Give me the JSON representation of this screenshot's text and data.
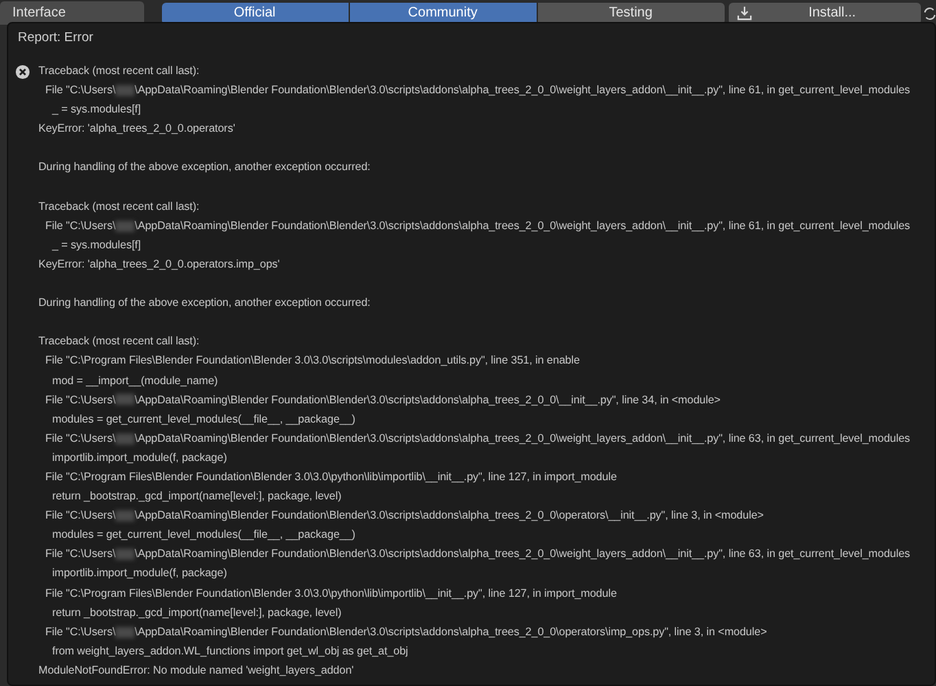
{
  "section_tab": {
    "label": "Interface"
  },
  "tabs": [
    {
      "label": "Official",
      "selected": true
    },
    {
      "label": "Community",
      "selected": true
    },
    {
      "label": "Testing",
      "selected": false
    }
  ],
  "install_button": {
    "label": "Install..."
  },
  "report": {
    "title": "Report: Error",
    "lines": [
      {
        "kind": "header",
        "text": "Traceback (most recent call last):"
      },
      {
        "kind": "file",
        "text": "File \"C:\\Users\\",
        "text_after": "\\AppData\\Roaming\\Blender Foundation\\Blender\\3.0\\scripts\\addons\\alpha_trees_2_0_0\\weight_layers_addon\\__init__.py\", line 61, in get_current_level_modules"
      },
      {
        "kind": "code",
        "text": "_ = sys.modules[f]"
      },
      {
        "kind": "header",
        "text": "KeyError: 'alpha_trees_2_0_0.operators'"
      },
      {
        "kind": "blank"
      },
      {
        "kind": "header",
        "text": "During handling of the above exception, another exception occurred:"
      },
      {
        "kind": "blank"
      },
      {
        "kind": "header",
        "text": "Traceback (most recent call last):"
      },
      {
        "kind": "file",
        "text": "File \"C:\\Users\\",
        "text_after": "\\AppData\\Roaming\\Blender Foundation\\Blender\\3.0\\scripts\\addons\\alpha_trees_2_0_0\\weight_layers_addon\\__init__.py\", line 61, in get_current_level_modules"
      },
      {
        "kind": "code",
        "text": "_ = sys.modules[f]"
      },
      {
        "kind": "header",
        "text": "KeyError: 'alpha_trees_2_0_0.operators.imp_ops'"
      },
      {
        "kind": "blank"
      },
      {
        "kind": "header",
        "text": "During handling of the above exception, another exception occurred:"
      },
      {
        "kind": "blank"
      },
      {
        "kind": "header",
        "text": "Traceback (most recent call last):"
      },
      {
        "kind": "file",
        "text": "File \"C:\\Program Files\\Blender Foundation\\Blender 3.0\\3.0\\scripts\\modules\\addon_utils.py\", line 351, in enable"
      },
      {
        "kind": "code",
        "text": "mod = __import__(module_name)"
      },
      {
        "kind": "file",
        "text": "File \"C:\\Users\\",
        "text_after": "\\AppData\\Roaming\\Blender Foundation\\Blender\\3.0\\scripts\\addons\\alpha_trees_2_0_0\\__init__.py\", line 34, in <module>"
      },
      {
        "kind": "code",
        "text": "modules = get_current_level_modules(__file__, __package__)"
      },
      {
        "kind": "file",
        "text": "File \"C:\\Users\\",
        "text_after": "\\AppData\\Roaming\\Blender Foundation\\Blender\\3.0\\scripts\\addons\\alpha_trees_2_0_0\\weight_layers_addon\\__init__.py\", line 63, in get_current_level_modules"
      },
      {
        "kind": "code",
        "text": "importlib.import_module(f, package)"
      },
      {
        "kind": "file",
        "text": "File \"C:\\Program Files\\Blender Foundation\\Blender 3.0\\3.0\\python\\lib\\importlib\\__init__.py\", line 127, in import_module"
      },
      {
        "kind": "code",
        "text": "return _bootstrap._gcd_import(name[level:], package, level)"
      },
      {
        "kind": "file",
        "text": "File \"C:\\Users\\",
        "text_after": "\\AppData\\Roaming\\Blender Foundation\\Blender\\3.0\\scripts\\addons\\alpha_trees_2_0_0\\operators\\__init__.py\", line 3, in <module>"
      },
      {
        "kind": "code",
        "text": "modules = get_current_level_modules(__file__, __package__)"
      },
      {
        "kind": "file",
        "text": "File \"C:\\Users\\",
        "text_after": "\\AppData\\Roaming\\Blender Foundation\\Blender\\3.0\\scripts\\addons\\alpha_trees_2_0_0\\weight_layers_addon\\__init__.py\", line 63, in get_current_level_modules"
      },
      {
        "kind": "code",
        "text": "importlib.import_module(f, package)"
      },
      {
        "kind": "file",
        "text": "File \"C:\\Program Files\\Blender Foundation\\Blender 3.0\\3.0\\python\\lib\\importlib\\__init__.py\", line 127, in import_module"
      },
      {
        "kind": "code",
        "text": "return _bootstrap._gcd_import(name[level:], package, level)"
      },
      {
        "kind": "file",
        "text": "File \"C:\\Users\\",
        "text_after": "\\AppData\\Roaming\\Blender Foundation\\Blender\\3.0\\scripts\\addons\\alpha_trees_2_0_0\\operators\\imp_ops.py\", line 3, in <module>"
      },
      {
        "kind": "code",
        "text": "from weight_layers_addon.WL_functions import get_wl_obj as get_at_obj"
      },
      {
        "kind": "header",
        "text": "ModuleNotFoundError: No module named 'weight_layers_addon'"
      }
    ]
  }
}
